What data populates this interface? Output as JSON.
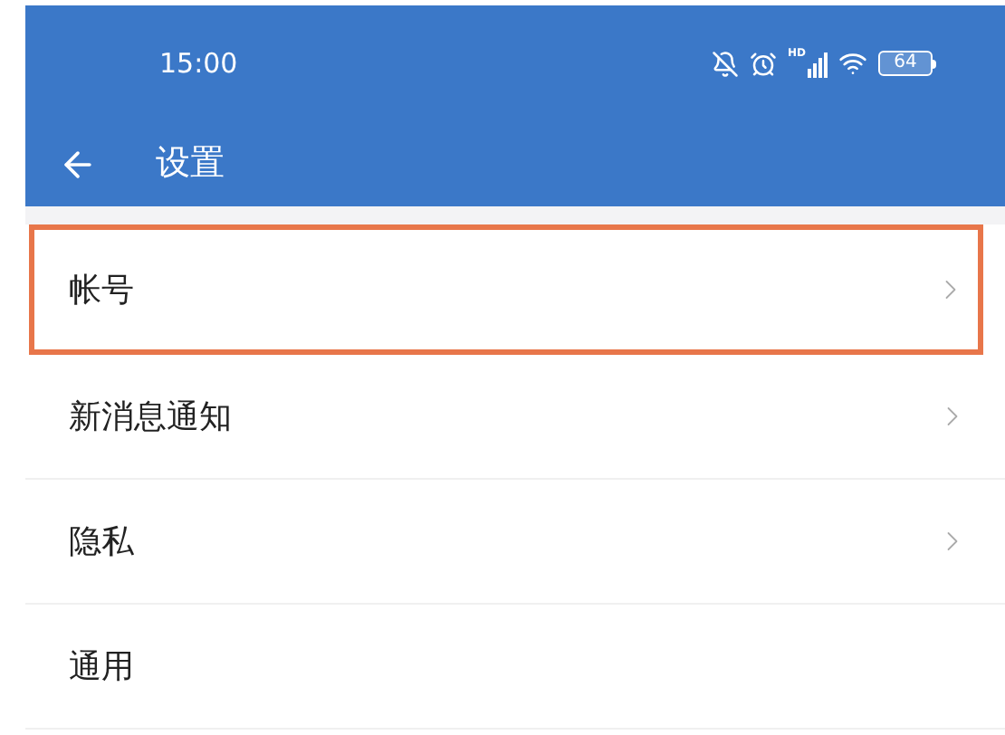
{
  "status_bar": {
    "time": "15:00",
    "signal_label": "HD",
    "battery": "64"
  },
  "header": {
    "title": "设置"
  },
  "items": [
    {
      "label": "帐号",
      "chevron": true,
      "highlighted": true
    },
    {
      "label": "新消息通知",
      "chevron": true,
      "highlighted": false
    },
    {
      "label": "隐私",
      "chevron": true,
      "highlighted": false
    },
    {
      "label": "通用",
      "chevron": false,
      "highlighted": false
    }
  ]
}
